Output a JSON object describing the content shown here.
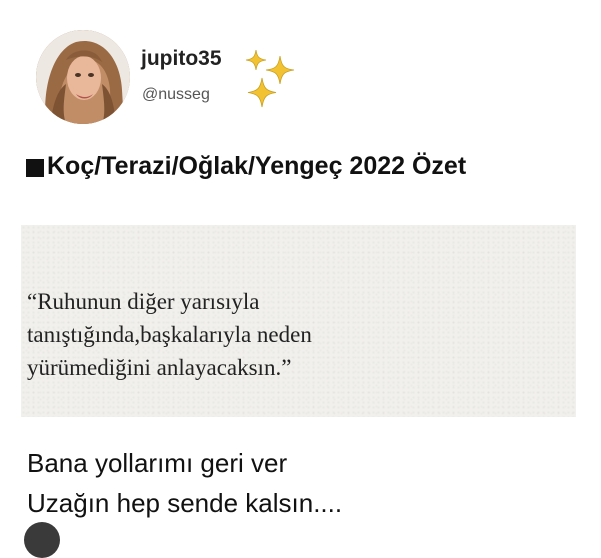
{
  "profile": {
    "username": "jupito35",
    "handle": "@nusseg"
  },
  "post": {
    "title": "Koç/Terazi/Oğlak/Yengeç 2022 Özet",
    "quote_lines": [
      "“Ruhunun diğer yarısıyla",
      "tanıştığında,başkalarıyla neden",
      "yürümediğini anlayacaksın.”"
    ],
    "body_lines": [
      "Bana yollarımı geri ver",
      "Uzağın hep sende kalsın...."
    ]
  },
  "colors": {
    "sparkle": "#f2c232",
    "quote_background": "#f1f0ec",
    "text": "#111111"
  },
  "icons": [
    "sparkles-icon",
    "black-square-icon"
  ]
}
